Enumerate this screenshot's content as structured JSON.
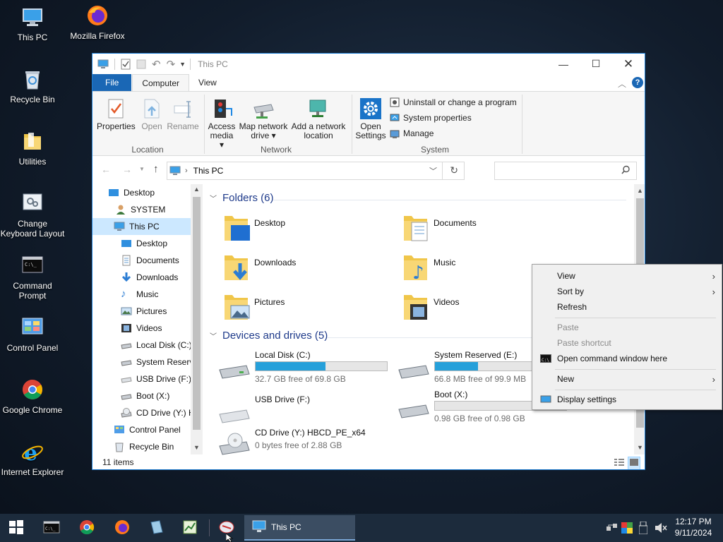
{
  "desktop": {
    "icons": [
      {
        "label": "This PC"
      },
      {
        "label": "Mozilla Firefox"
      },
      {
        "label": "Recycle Bin"
      },
      {
        "label": "Utilities"
      },
      {
        "label": "Change Keyboard Layout"
      },
      {
        "label": "Command Prompt"
      },
      {
        "label": "Control Panel"
      },
      {
        "label": "Google Chrome"
      },
      {
        "label": "Internet Explorer"
      }
    ]
  },
  "window": {
    "title": "This PC",
    "tabs": {
      "file": "File",
      "computer": "Computer",
      "view": "View"
    },
    "ribbon": {
      "location": {
        "label": "Location",
        "properties": "Properties",
        "open": "Open",
        "rename": "Rename"
      },
      "network": {
        "label": "Network",
        "access_media": "Access media",
        "map_drive": "Map network drive",
        "add_location": "Add a network location"
      },
      "system": {
        "label": "System",
        "open_settings": "Open Settings",
        "uninstall": "Uninstall or change a program",
        "properties": "System properties",
        "manage": "Manage"
      }
    },
    "address": {
      "path": "This PC"
    },
    "nav": [
      {
        "label": "Desktop"
      },
      {
        "label": "SYSTEM"
      },
      {
        "label": "This PC"
      },
      {
        "label": "Desktop"
      },
      {
        "label": "Documents"
      },
      {
        "label": "Downloads"
      },
      {
        "label": "Music"
      },
      {
        "label": "Pictures"
      },
      {
        "label": "Videos"
      },
      {
        "label": "Local Disk (C:)"
      },
      {
        "label": "System Reserve"
      },
      {
        "label": "USB Drive (F:)"
      },
      {
        "label": "Boot (X:)"
      },
      {
        "label": "CD Drive (Y:) H"
      },
      {
        "label": "Control Panel"
      },
      {
        "label": "Recycle Bin"
      }
    ],
    "folders_header": "Folders (6)",
    "folders": [
      {
        "label": "Desktop"
      },
      {
        "label": "Documents"
      },
      {
        "label": "Downloads"
      },
      {
        "label": "Music"
      },
      {
        "label": "Pictures"
      },
      {
        "label": "Videos"
      }
    ],
    "drives_header": "Devices and drives (5)",
    "drives": [
      {
        "label": "Local Disk (C:)",
        "free": "32.7 GB free of 69.8 GB",
        "used_fraction": 0.53
      },
      {
        "label": "System Reserved (E:)",
        "free": "66.8 MB free of 99.9 MB",
        "used_fraction": 0.33
      },
      {
        "label": "USB Drive (F:)"
      },
      {
        "label": "Boot (X:)",
        "free": "0.98 GB free of 0.98 GB",
        "used_fraction": 0.0
      },
      {
        "label": "CD Drive (Y:) HBCD_PE_x64",
        "free": "0 bytes free of 2.88 GB"
      }
    ],
    "status": "11 items"
  },
  "context_menu": {
    "view": "View",
    "sort_by": "Sort by",
    "refresh": "Refresh",
    "paste": "Paste",
    "paste_shortcut": "Paste shortcut",
    "open_cmd": "Open command window here",
    "new": "New",
    "display_settings": "Display settings"
  },
  "taskbar": {
    "active_window": "This PC",
    "time": "12:17 PM",
    "date": "9/11/2024"
  },
  "colors": {
    "accent": "#1a67b5",
    "progress": "#26a0da",
    "selection": "#cce8ff"
  }
}
